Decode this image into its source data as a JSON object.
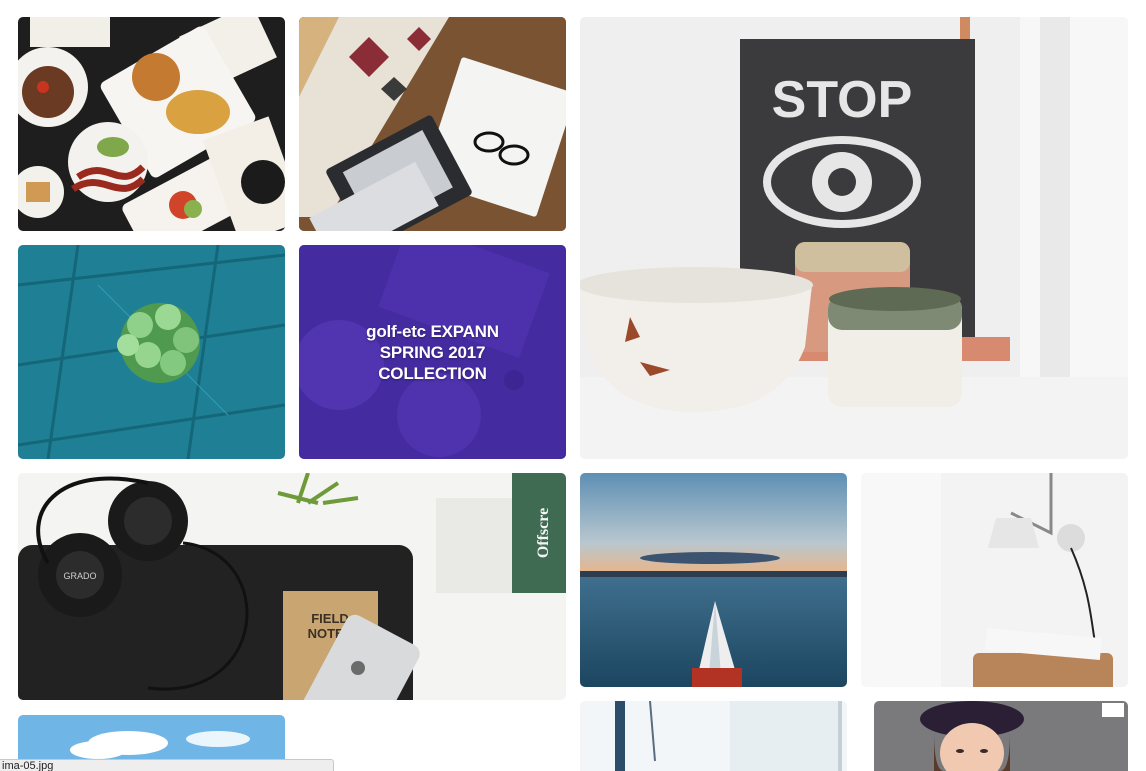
{
  "gallery": {
    "featured_text": "golf-etc EXPANN\nSPRING 2017\nCOLLECTION",
    "poster_text": "STOP",
    "notebook_text": "FIELD\nNOTES",
    "spine_text": "Offscre",
    "headphones_text": "GRADO"
  },
  "status_bar": {
    "url": "ima-05.jpg"
  },
  "colors": {
    "overlay_purple": "#4a2bb0",
    "teal": "#1f7f95",
    "ocean": "#2d5f7c"
  }
}
